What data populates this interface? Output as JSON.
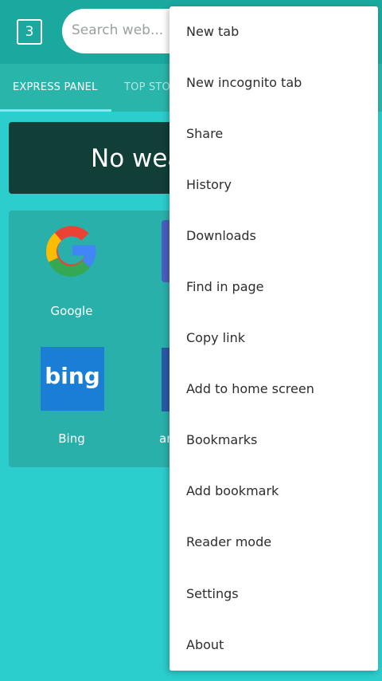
{
  "topbar": {
    "tab_count": "3",
    "search_placeholder": "Search web..."
  },
  "tabs": [
    {
      "label": "EXPRESS PANEL"
    },
    {
      "label": "TOP STOR"
    }
  ],
  "weather": {
    "text": "No wea"
  },
  "tiles": [
    {
      "label": "Google"
    },
    {
      "label": "Bing",
      "logo_text": "bing"
    },
    {
      "label": "an"
    }
  ],
  "menu": {
    "items": [
      {
        "label": "New tab"
      },
      {
        "label": "New incognito tab"
      },
      {
        "label": "Share"
      },
      {
        "label": "History"
      },
      {
        "label": "Downloads"
      },
      {
        "label": "Find in page"
      },
      {
        "label": "Copy link"
      },
      {
        "label": "Add to home screen"
      },
      {
        "label": "Bookmarks"
      },
      {
        "label": "Add bookmark"
      },
      {
        "label": "Reader mode"
      },
      {
        "label": "Settings"
      },
      {
        "label": "About"
      }
    ]
  },
  "colors": {
    "background": "#2ccdcd",
    "topbar": "#1ba99f",
    "tabsbar": "#2ab5ab",
    "weather_card": "#113f38",
    "bing_blue": "#1a7ed6",
    "menu_bg": "#ffffff"
  }
}
